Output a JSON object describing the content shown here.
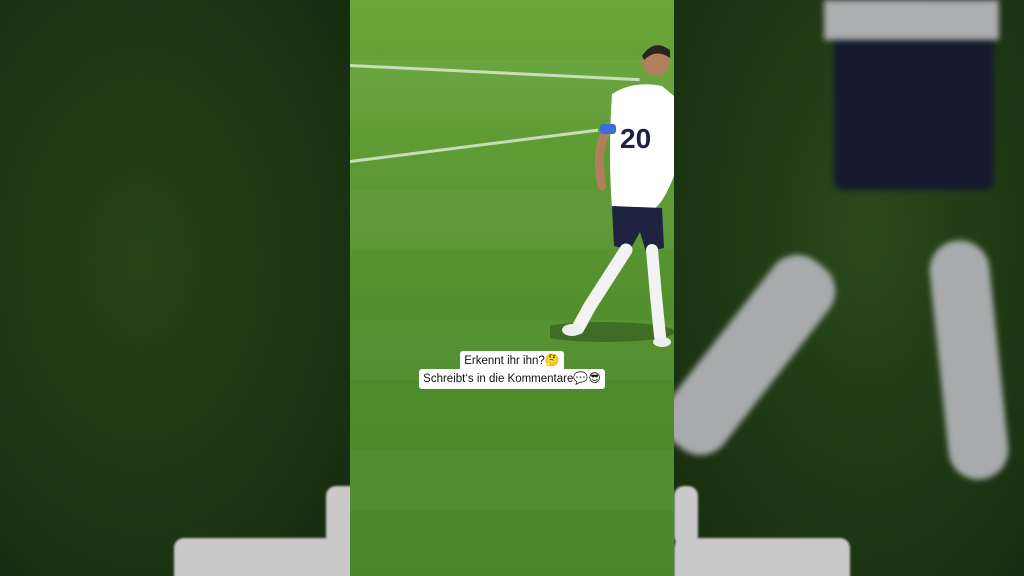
{
  "caption": {
    "line1": "Erkennt ihr ihn?",
    "line1_emoji": "🤔",
    "line2": "Schreibt‘s in die Kommentare",
    "line2_emoji": "💬😎"
  },
  "player": {
    "shirt_number": "20"
  },
  "colors": {
    "pitch": "#5e9a33",
    "shirt": "#ffffff",
    "shorts": "#1d2340",
    "armband": "#3a6fd8"
  }
}
